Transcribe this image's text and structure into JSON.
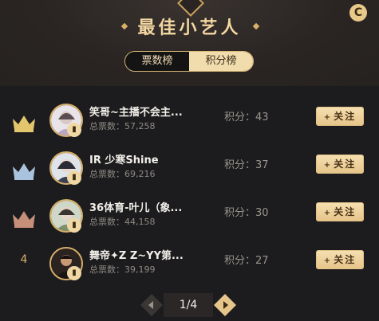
{
  "header": {
    "title": "最佳小艺人",
    "refresh_label": "C"
  },
  "tabs": [
    {
      "label": "票数榜",
      "active": true
    },
    {
      "label": "积分榜",
      "active": false
    }
  ],
  "rows": [
    {
      "rank": "1",
      "name": "笑哥~主播不会主...",
      "votes": "总票数：57,258",
      "score": "积分：43",
      "follow": "关注",
      "crown_color": "#e2c56c"
    },
    {
      "rank": "2",
      "name": "IR 少寒Shine",
      "votes": "总票数：69,216",
      "score": "积分：37",
      "follow": "关注",
      "crown_color": "#a9c3de"
    },
    {
      "rank": "3",
      "name": "36体育-叶儿（象...",
      "votes": "总票数：44,158",
      "score": "积分：30",
      "follow": "关注",
      "crown_color": "#c58f79"
    },
    {
      "rank": "4",
      "name": "舞帝✦Z Z~YY第...",
      "votes": "总票数：39,199",
      "score": "积分：27",
      "follow": "关注"
    }
  ],
  "pager": {
    "label": "1/4"
  },
  "colors": {
    "accent": "#d8b06a",
    "button_bg": "#f1dcae",
    "background": "#1c1c1e"
  },
  "icons": {
    "refresh": "refresh-icon",
    "mic": "mic-icon",
    "crown": "crown-icon"
  }
}
